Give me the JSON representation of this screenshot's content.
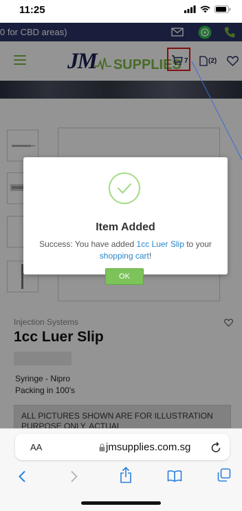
{
  "status_bar": {
    "time": "11:25"
  },
  "promo_bar": {
    "text": "0 for CBD areas)"
  },
  "header": {
    "logo_jm": "JM",
    "logo_supplies": "SUPPLIES",
    "cart_count": "7",
    "compare_count": "(2)"
  },
  "product": {
    "category": "Injection Systems",
    "title": "1cc Luer Slip",
    "description_line1": "Syringe - Nipro",
    "description_line2": "Packing in 100's",
    "notice": "ALL PICTURES SHOWN ARE FOR ILLUSTRATION PURPOSE ONLY. ACTUAL"
  },
  "modal": {
    "title": "Item Added",
    "msg_prefix": "Success: You have added ",
    "msg_product": "1cc Luer Slip",
    "msg_mid": " to your ",
    "msg_cart": "shopping cart",
    "msg_suffix": "!",
    "ok_label": "OK"
  },
  "browser": {
    "aa_label": "AA",
    "url": "jmsupplies.com.sg"
  },
  "colors": {
    "brand_navy": "#1d2457",
    "brand_green": "#7db842",
    "highlight_red": "#e01b1b",
    "link_blue": "#2a86c8"
  }
}
